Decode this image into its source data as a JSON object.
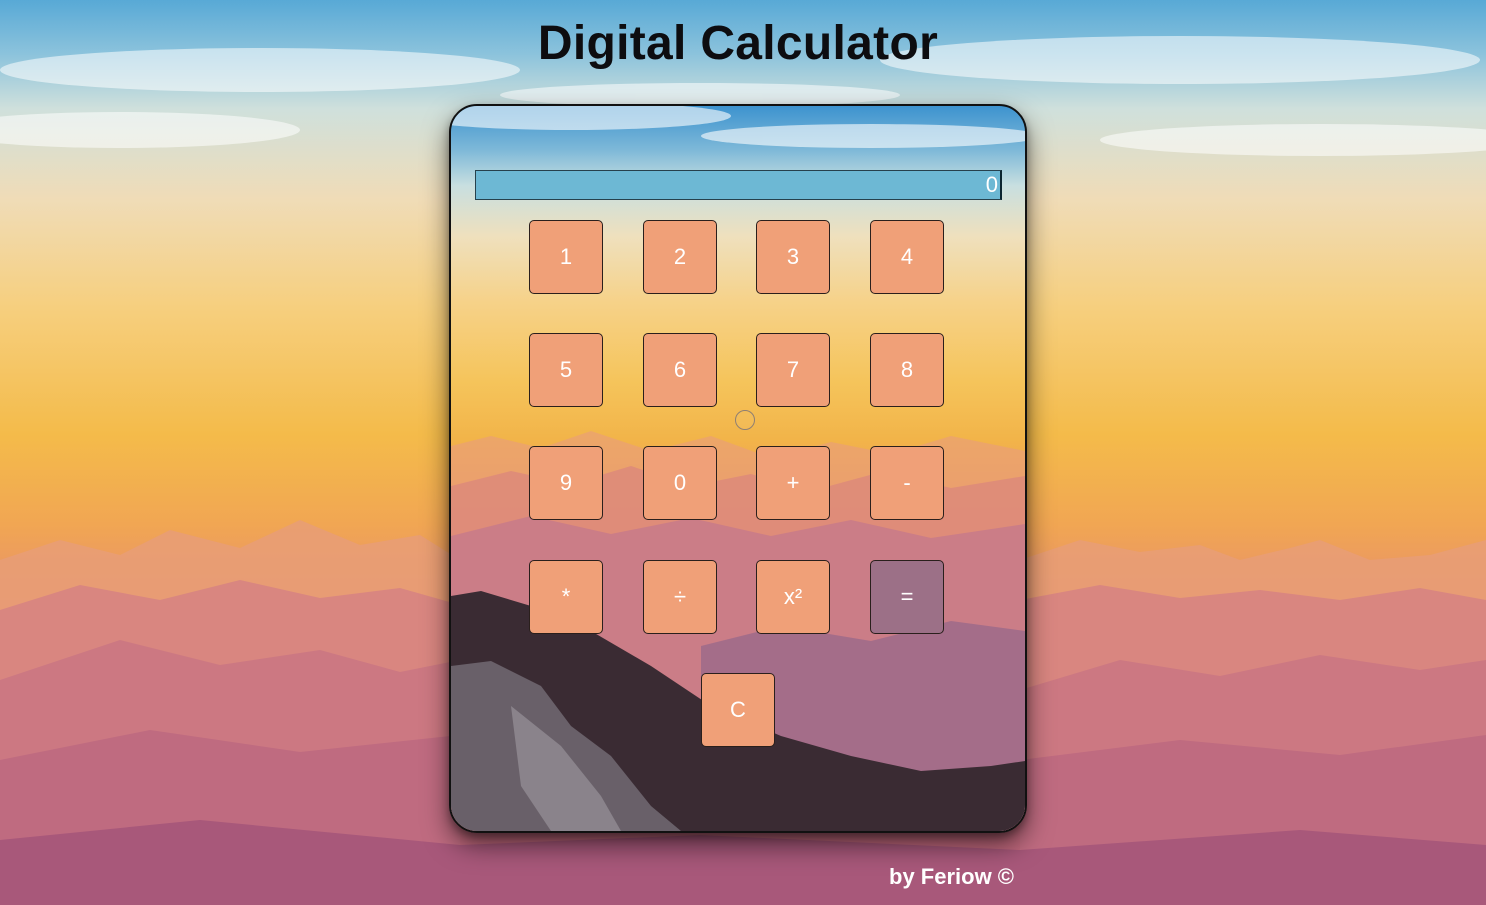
{
  "page": {
    "title": "Digital Calculator",
    "credit": "by Feriow ©"
  },
  "calculator": {
    "display_value": "0",
    "keys": {
      "k1": "1",
      "k2": "2",
      "k3": "3",
      "k4": "4",
      "k5": "5",
      "k6": "6",
      "k7": "7",
      "k8": "8",
      "k9": "9",
      "k0": "0",
      "plus": "+",
      "minus": "-",
      "multiply": "*",
      "divide": "÷",
      "square": "x²",
      "equals": "=",
      "clear": "C"
    }
  },
  "colors": {
    "key": "#f0a078",
    "key_equals": "#9c7087",
    "display": "#6db8d4",
    "title": "#0d0d10"
  }
}
